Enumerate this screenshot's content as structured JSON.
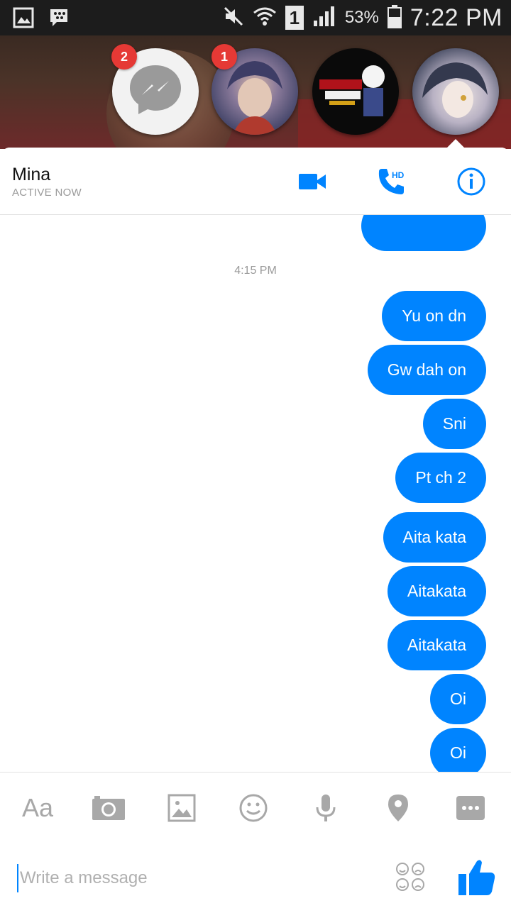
{
  "status_bar": {
    "battery": "53%",
    "signal_carrier_label": "1",
    "time": "7:22 PM",
    "icons": [
      "gallery-icon",
      "bbm-icon",
      "mute-icon",
      "wifi-icon",
      "sim-icon",
      "signal-icon",
      "battery-icon"
    ]
  },
  "chat_heads": [
    {
      "name": "messenger-home",
      "badge": "2"
    },
    {
      "name": "contact-anime-boy",
      "badge": "1"
    },
    {
      "name": "contact-dragon-nest",
      "badge": ""
    },
    {
      "name": "contact-mina",
      "badge": ""
    }
  ],
  "header": {
    "contact_name": "Mina",
    "status": "ACTIVE NOW",
    "call_badge": "HD"
  },
  "conversation": {
    "timestamp": "4:15 PM",
    "messages": [
      "Yu on dn",
      "Gw dah on",
      "Sni",
      "Pt ch 2",
      "Aita kata",
      "Aitakata",
      "Aitakata",
      "Oi",
      "Oi"
    ]
  },
  "toolbar": {
    "text_label": "Aa",
    "items": [
      "text-format",
      "camera",
      "gallery",
      "emoji",
      "microphone",
      "location",
      "more"
    ]
  },
  "composer": {
    "placeholder": "Write a message"
  },
  "colors": {
    "accent": "#0084ff",
    "badge": "#e53935",
    "icon_gray": "#a8a8a8"
  }
}
